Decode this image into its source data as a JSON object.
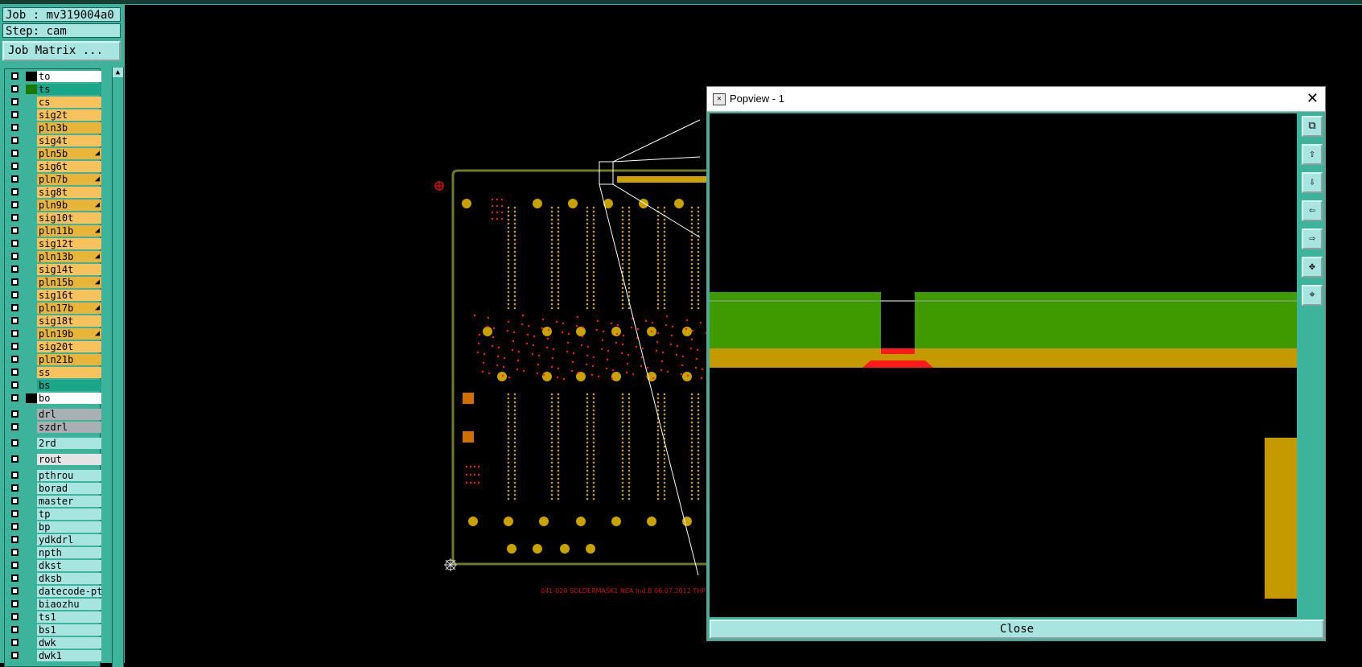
{
  "job": "Job : mv319004a0",
  "step": "Step: cam",
  "job_matrix_label": "Job Matrix ...",
  "scroll_up": "▲",
  "layers": [
    {
      "name": "to",
      "bg": "#ffffff",
      "swatch": "#000000",
      "mark": ""
    },
    {
      "name": "ts",
      "bg": "#1aa688",
      "swatch": "#1a7a00",
      "mark": ""
    },
    {
      "name": "cs",
      "bg": "#f7c15e",
      "swatch": "",
      "mark": ""
    },
    {
      "name": "sig2t",
      "bg": "#f7c15e",
      "swatch": "",
      "mark": ""
    },
    {
      "name": "pln3b",
      "bg": "#e8b43a",
      "swatch": "",
      "mark": ""
    },
    {
      "name": "sig4t",
      "bg": "#f7c15e",
      "swatch": "",
      "mark": ""
    },
    {
      "name": "pln5b",
      "bg": "#e8b43a",
      "swatch": "",
      "mark": "◢"
    },
    {
      "name": "sig6t",
      "bg": "#f7c15e",
      "swatch": "",
      "mark": ""
    },
    {
      "name": "pln7b",
      "bg": "#e8b43a",
      "swatch": "",
      "mark": "◢"
    },
    {
      "name": "sig8t",
      "bg": "#f7c15e",
      "swatch": "",
      "mark": ""
    },
    {
      "name": "pln9b",
      "bg": "#e8b43a",
      "swatch": "",
      "mark": "◢"
    },
    {
      "name": "sig10t",
      "bg": "#f7c15e",
      "swatch": "",
      "mark": ""
    },
    {
      "name": "pln11b",
      "bg": "#e8b43a",
      "swatch": "",
      "mark": "◢"
    },
    {
      "name": "sig12t",
      "bg": "#f7c15e",
      "swatch": "",
      "mark": ""
    },
    {
      "name": "pln13b",
      "bg": "#e8b43a",
      "swatch": "",
      "mark": "◢"
    },
    {
      "name": "sig14t",
      "bg": "#f7c15e",
      "swatch": "",
      "mark": ""
    },
    {
      "name": "pln15b",
      "bg": "#e8b43a",
      "swatch": "",
      "mark": "◢"
    },
    {
      "name": "sig16t",
      "bg": "#f7c15e",
      "swatch": "",
      "mark": ""
    },
    {
      "name": "pln17b",
      "bg": "#e8b43a",
      "swatch": "",
      "mark": "◢"
    },
    {
      "name": "sig18t",
      "bg": "#f7c15e",
      "swatch": "",
      "mark": ""
    },
    {
      "name": "pln19b",
      "bg": "#e8b43a",
      "swatch": "",
      "mark": "◢"
    },
    {
      "name": "sig20t",
      "bg": "#f7c15e",
      "swatch": "",
      "mark": ""
    },
    {
      "name": "pln21b",
      "bg": "#e8b43a",
      "swatch": "",
      "mark": ""
    },
    {
      "name": "ss",
      "bg": "#f7c15e",
      "swatch": "",
      "mark": ""
    },
    {
      "name": "bs",
      "bg": "#1aa688",
      "swatch": "",
      "mark": ""
    },
    {
      "name": "bo",
      "bg": "#ffffff",
      "swatch": "#000000",
      "mark": ""
    },
    {
      "name": "drl",
      "bg": "#a9b0b4",
      "swatch": "",
      "mark": "",
      "gap": 4
    },
    {
      "name": "szdrl",
      "bg": "#a9b0b4",
      "swatch": "",
      "mark": ""
    },
    {
      "name": "2rd",
      "bg": "#a8e4e0",
      "swatch": "",
      "mark": "",
      "gap": 4
    },
    {
      "name": "rout",
      "bg": "#e4e4e4",
      "swatch": "",
      "mark": "",
      "gap": 4
    },
    {
      "name": "pthrou",
      "bg": "#a8e4e0",
      "swatch": "",
      "mark": "",
      "gap": 4
    },
    {
      "name": "borad",
      "bg": "#a8e4e0",
      "swatch": "",
      "mark": ""
    },
    {
      "name": "master",
      "bg": "#a8e4e0",
      "swatch": "",
      "mark": ""
    },
    {
      "name": "tp",
      "bg": "#a8e4e0",
      "swatch": "",
      "mark": ""
    },
    {
      "name": "bp",
      "bg": "#a8e4e0",
      "swatch": "",
      "mark": ""
    },
    {
      "name": "ydkdrl",
      "bg": "#a8e4e0",
      "swatch": "",
      "mark": ""
    },
    {
      "name": "npth",
      "bg": "#a8e4e0",
      "swatch": "",
      "mark": ""
    },
    {
      "name": "dkst",
      "bg": "#a8e4e0",
      "swatch": "",
      "mark": ""
    },
    {
      "name": "dksb",
      "bg": "#a8e4e0",
      "swatch": "",
      "mark": ""
    },
    {
      "name": "datecode-pto",
      "bg": "#a8e4e0",
      "swatch": "",
      "mark": ""
    },
    {
      "name": "biaozhu",
      "bg": "#a8e4e0",
      "swatch": "",
      "mark": ""
    },
    {
      "name": "ts1",
      "bg": "#a8e4e0",
      "swatch": "",
      "mark": ""
    },
    {
      "name": "bs1",
      "bg": "#a8e4e0",
      "swatch": "",
      "mark": ""
    },
    {
      "name": "dwk",
      "bg": "#a8e4e0",
      "swatch": "",
      "mark": ""
    },
    {
      "name": "dwk1",
      "bg": "#a8e4e0",
      "swatch": "",
      "mark": ""
    }
  ],
  "board_label": "041-028 SOLDERMASK1 NEA Ind.B  06.07.2012 THP",
  "popview": {
    "title": "Popview - 1",
    "close_x": "✕",
    "close_button": "Close",
    "tools": [
      {
        "name": "fit-icon",
        "glyph": "⧉"
      },
      {
        "name": "move-up-icon",
        "glyph": "⇧"
      },
      {
        "name": "move-down-icon",
        "glyph": "⇩"
      },
      {
        "name": "move-left-icon",
        "glyph": "⇦"
      },
      {
        "name": "move-right-icon",
        "glyph": "⇨"
      },
      {
        "name": "zoom-in-icon",
        "glyph": "✥"
      },
      {
        "name": "zoom-out-icon",
        "glyph": "⌖"
      }
    ]
  },
  "colors": {
    "panel": "#3cb39a",
    "button": "#a8e4e0",
    "board_outline": "#6c7a2a",
    "pad": "#c9a200",
    "mask_green": "#3f9a00",
    "copper": "#c49a00",
    "red": "#ff1a1a"
  }
}
